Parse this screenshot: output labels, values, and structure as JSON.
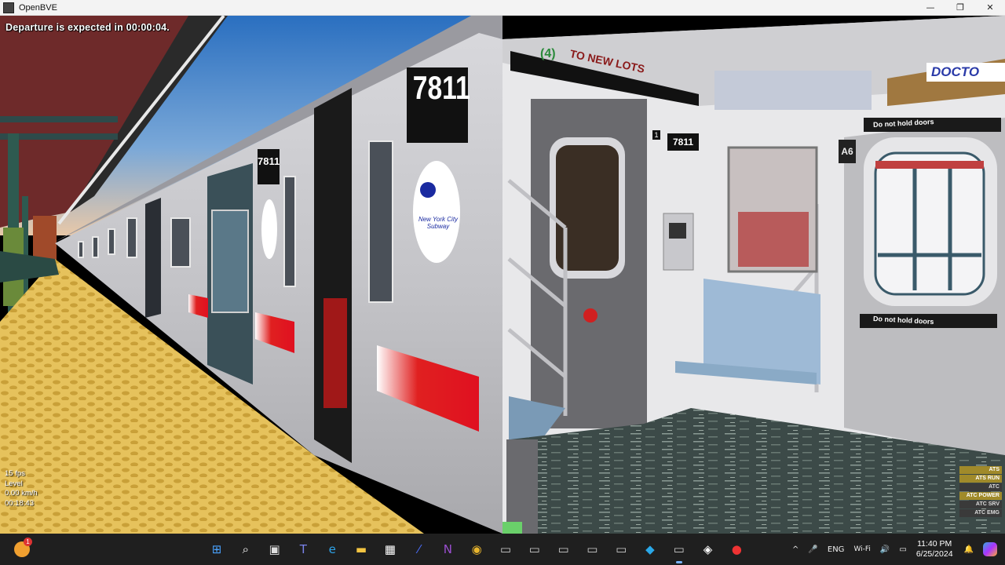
{
  "window": {
    "title": "OpenBVE",
    "controls": {
      "minimize": "—",
      "maximize": "❐",
      "close": "✕"
    }
  },
  "hud": {
    "message": "Departure is expected in 00:00:04.",
    "stats": {
      "fps": "15 fps",
      "level": "Level",
      "speed": "0.00 km/h",
      "time": "00:18:43"
    },
    "ats_panel": [
      {
        "label": "ATS",
        "state": "on"
      },
      {
        "label": "ATS RUN",
        "state": "on"
      },
      {
        "label": "ATC",
        "state": "off"
      },
      {
        "label": "ATC POWER",
        "state": "on"
      },
      {
        "label": "ATC SRV",
        "state": "off"
      },
      {
        "label": "ATC EMG",
        "state": "off"
      }
    ]
  },
  "scene": {
    "car_number_large": "7811",
    "car_number_small": "7811",
    "car_number_cab": "7811",
    "destination_route": "(4)",
    "destination_text": "TO NEW LOTS",
    "roundel_text": "New York City Subway",
    "cab_plate_1": "1",
    "cab_plate_2": "A6",
    "sign_do_not_hold_1": "Do not hold doors",
    "sign_do_not_hold_2": "Do not hold doors",
    "ad_text": "DOCTO"
  },
  "taskbar": {
    "weather_badge": "1",
    "pinned": [
      {
        "name": "start-button",
        "glyph": "⊞",
        "color": "#4aa3ff"
      },
      {
        "name": "search-button",
        "glyph": "⌕",
        "color": "#ffffff"
      },
      {
        "name": "task-view-button",
        "glyph": "▣",
        "color": "#dddddd"
      },
      {
        "name": "teams-icon",
        "glyph": "T",
        "color": "#7b83eb"
      },
      {
        "name": "edge-icon",
        "glyph": "e",
        "color": "#2ea3e8"
      },
      {
        "name": "file-explorer-icon",
        "glyph": "▬",
        "color": "#f4c542"
      },
      {
        "name": "store-icon",
        "glyph": "▦",
        "color": "#ffffff"
      },
      {
        "name": "app-icon-blue",
        "glyph": "⁄",
        "color": "#4a6cf7"
      },
      {
        "name": "onenote-icon",
        "glyph": "N",
        "color": "#9b4fd0"
      },
      {
        "name": "chrome-icon",
        "glyph": "◉",
        "color": "#e8b52e"
      },
      {
        "name": "openbve-icon-1",
        "glyph": "▭",
        "color": "#cccccc"
      },
      {
        "name": "openbve-icon-2",
        "glyph": "▭",
        "color": "#cccccc"
      },
      {
        "name": "openbve-icon-3",
        "glyph": "▭",
        "color": "#cccccc"
      },
      {
        "name": "openbve-icon-4",
        "glyph": "▭",
        "color": "#cccccc"
      },
      {
        "name": "openbve-icon-5",
        "glyph": "▭",
        "color": "#cccccc"
      },
      {
        "name": "app-icon-cyan",
        "glyph": "◆",
        "color": "#2aa8e8"
      },
      {
        "name": "openbve-icon-active",
        "glyph": "▭",
        "color": "#cccccc",
        "active": true
      },
      {
        "name": "app-icon-white",
        "glyph": "◈",
        "color": "#ffffff"
      },
      {
        "name": "recorder-icon",
        "glyph": "●",
        "color": "#e33"
      }
    ],
    "tray": {
      "chevron": "^",
      "mic": "🎤",
      "language": "ENG",
      "network": "Wi-Fi",
      "volume": "🔊",
      "battery": "▭",
      "time": "11:40 PM",
      "date": "6/25/2024",
      "notification": "🔔"
    }
  }
}
